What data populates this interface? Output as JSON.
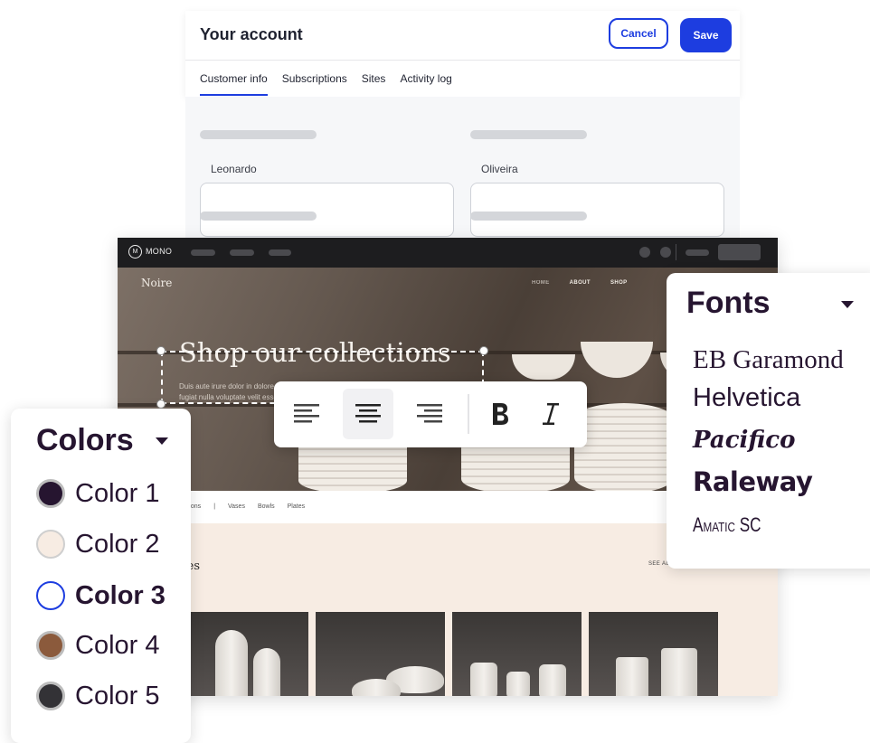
{
  "account": {
    "title": "Your account",
    "cancel_label": "Cancel",
    "save_label": "Save",
    "tabs": [
      {
        "label": "Customer info",
        "active": true
      },
      {
        "label": "Subscriptions",
        "active": false
      },
      {
        "label": "Sites",
        "active": false
      },
      {
        "label": "Activity log",
        "active": false
      }
    ],
    "first_name": "Leonardo",
    "last_name": "Oliveira"
  },
  "site": {
    "app_name": "MONO",
    "brand": "Noire",
    "nav": [
      "HOME",
      "ABOUT",
      "SHOP"
    ],
    "heading": "Shop our collections",
    "paragraph": "Duis aute irure dolor in dolore eu fugiat nulla voluptate velit esse",
    "filters": [
      "ections",
      "|",
      "Vases",
      "Bowls",
      "Plates"
    ],
    "section_title": "ses",
    "see_all": "SEE AL"
  },
  "toolbar": {
    "tools": [
      "align-left",
      "align-center",
      "align-right",
      "bold",
      "italic"
    ],
    "active": "align-center"
  },
  "colors": {
    "title": "Colors",
    "items": [
      {
        "label": "Color 1",
        "swatch": "#261530",
        "border": "#bdbdbd",
        "selected": false
      },
      {
        "label": "Color 2",
        "swatch": "#f7ece3",
        "border": "#cfcfcf",
        "selected": false
      },
      {
        "label": "Color 3",
        "swatch": "#ffffff",
        "border": "#1d3de0",
        "selected": true
      },
      {
        "label": "Color 4",
        "swatch": "#8b5a3c",
        "border": "#bdbdbd",
        "selected": false
      },
      {
        "label": "Color 5",
        "swatch": "#333236",
        "border": "#bdbdbd",
        "selected": false
      }
    ]
  },
  "fonts": {
    "title": "Fonts",
    "items": [
      "EB Garamond",
      "Helvetica",
      "Pacifico",
      "Raleway",
      "Amatic SC"
    ]
  },
  "accent_color": "#1d3de0"
}
